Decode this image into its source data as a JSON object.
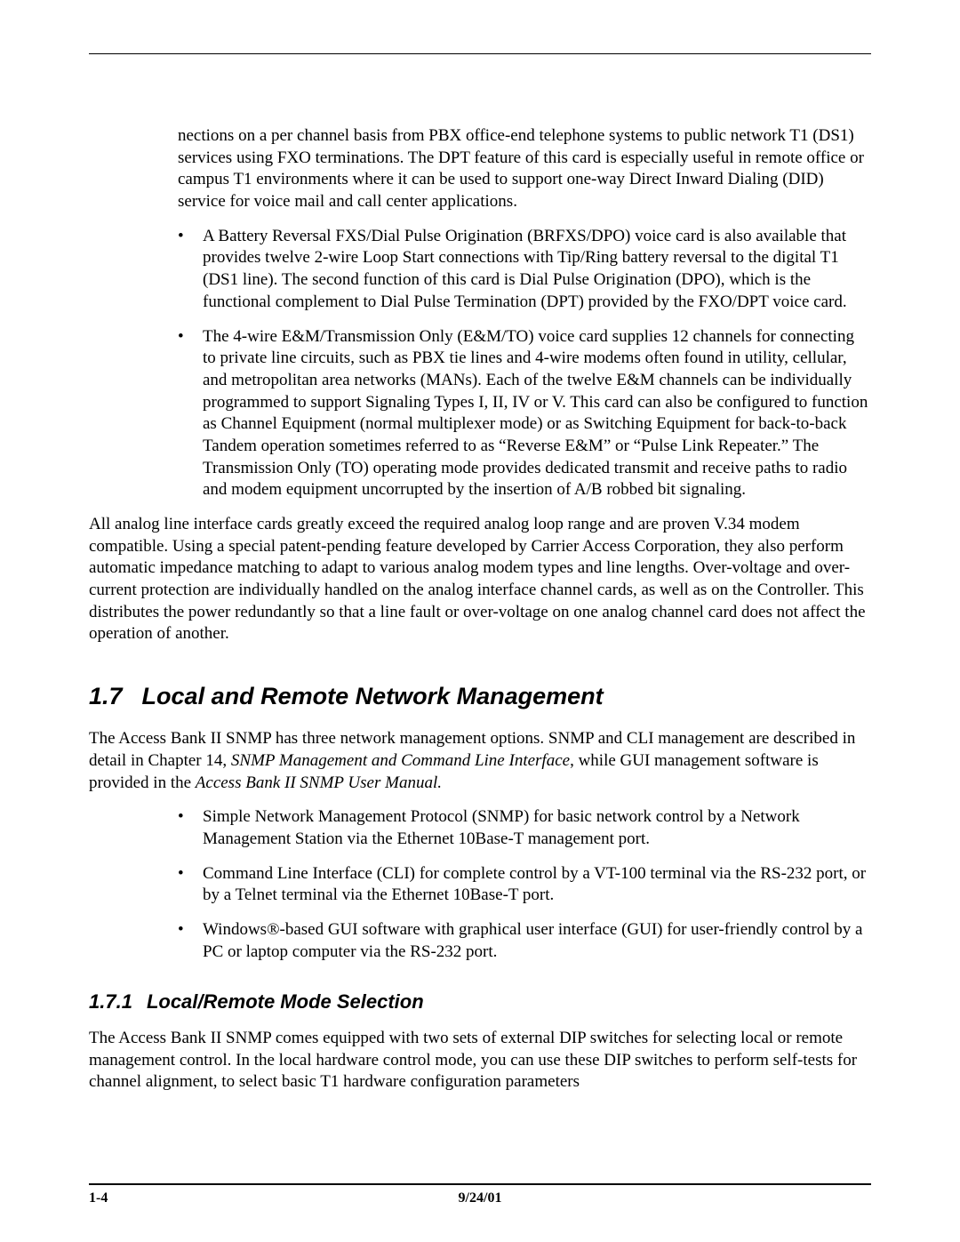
{
  "intro_continuation": "nections on a per channel basis from PBX office-end telephone systems to public network T1 (DS1) services using FXO terminations. The DPT feature of this card is especially useful in remote office or campus T1 environments where it can be used to support one-way Direct Inward Dialing (DID) service for voice mail and call center applications.",
  "top_bullets": [
    "A Battery Reversal FXS/Dial Pulse Origination (BRFXS/DPO) voice card is also available that provides twelve 2-wire Loop Start connections with Tip/Ring battery reversal to the digital T1 (DS1 line). The second function of this card is Dial Pulse Origination (DPO), which is the functional complement to Dial Pulse Termination (DPT) provided by the FXO/DPT voice card.",
    "The 4-wire E&M/Transmission Only (E&M/TO) voice card supplies 12 channels for connecting to private line circuits, such as PBX tie lines and 4-wire modems often found in utility, cellular, and metropolitan area networks (MANs). Each of the twelve E&M channels can be individually programmed to support Signaling Types I, II, IV or V. This card can also be configured to function as Channel Equipment (normal multiplexer mode) or as Switching Equipment for back-to-back Tandem operation sometimes referred to as “Reverse E&M” or “Pulse Link Repeater.” The Transmission Only (TO) operating mode provides dedicated transmit and receive paths to radio and modem equipment uncorrupted by the insertion of A/B robbed bit signaling."
  ],
  "summary_para": "All analog line interface cards greatly exceed the required analog loop range and are proven V.34 modem compatible. Using a special patent-pending feature developed by Carrier Access Corporation, they also perform automatic impedance matching to adapt to various analog modem types and line lengths. Over-voltage and over-current protection are individually handled on the analog interface channel cards, as well as on the Controller. This distributes the power redundantly so that a line fault or over-voltage on one analog channel card does not affect the operation of another.",
  "section_1_7": {
    "number": "1.7",
    "title": "Local and Remote Network Management",
    "intro_pre": "The Access Bank II SNMP has three network management options. SNMP and CLI  management are described in detail in Chapter 14, ",
    "intro_italic1": "SNMP Management and Command Line Interface",
    "intro_mid": ", while GUI management software is provided in the ",
    "intro_italic2": "Access Bank II SNMP User Manual.",
    "bullets": [
      "Simple Network Management Protocol (SNMP) for basic network control by a Network Management Station via the Ethernet 10Base-T management port.",
      "Command Line Interface (CLI) for complete control by a VT-100 terminal via the RS-232 port, or by a Telnet terminal via the Ethernet 10Base-T port.",
      "Windows®-based GUI software with graphical user interface (GUI) for user-friendly control by a PC or laptop computer via the RS-232 port."
    ]
  },
  "section_1_7_1": {
    "number": "1.7.1",
    "title": "Local/Remote Mode Selection",
    "para": "The Access Bank II SNMP comes equipped with two sets of external DIP switches for selecting local or remote management control. In the local hardware control mode, you can use these DIP switches to perform self-tests for channel alignment, to select basic T1 hardware configuration parameters"
  },
  "footer": {
    "page": "1-4",
    "date": "9/24/01"
  }
}
